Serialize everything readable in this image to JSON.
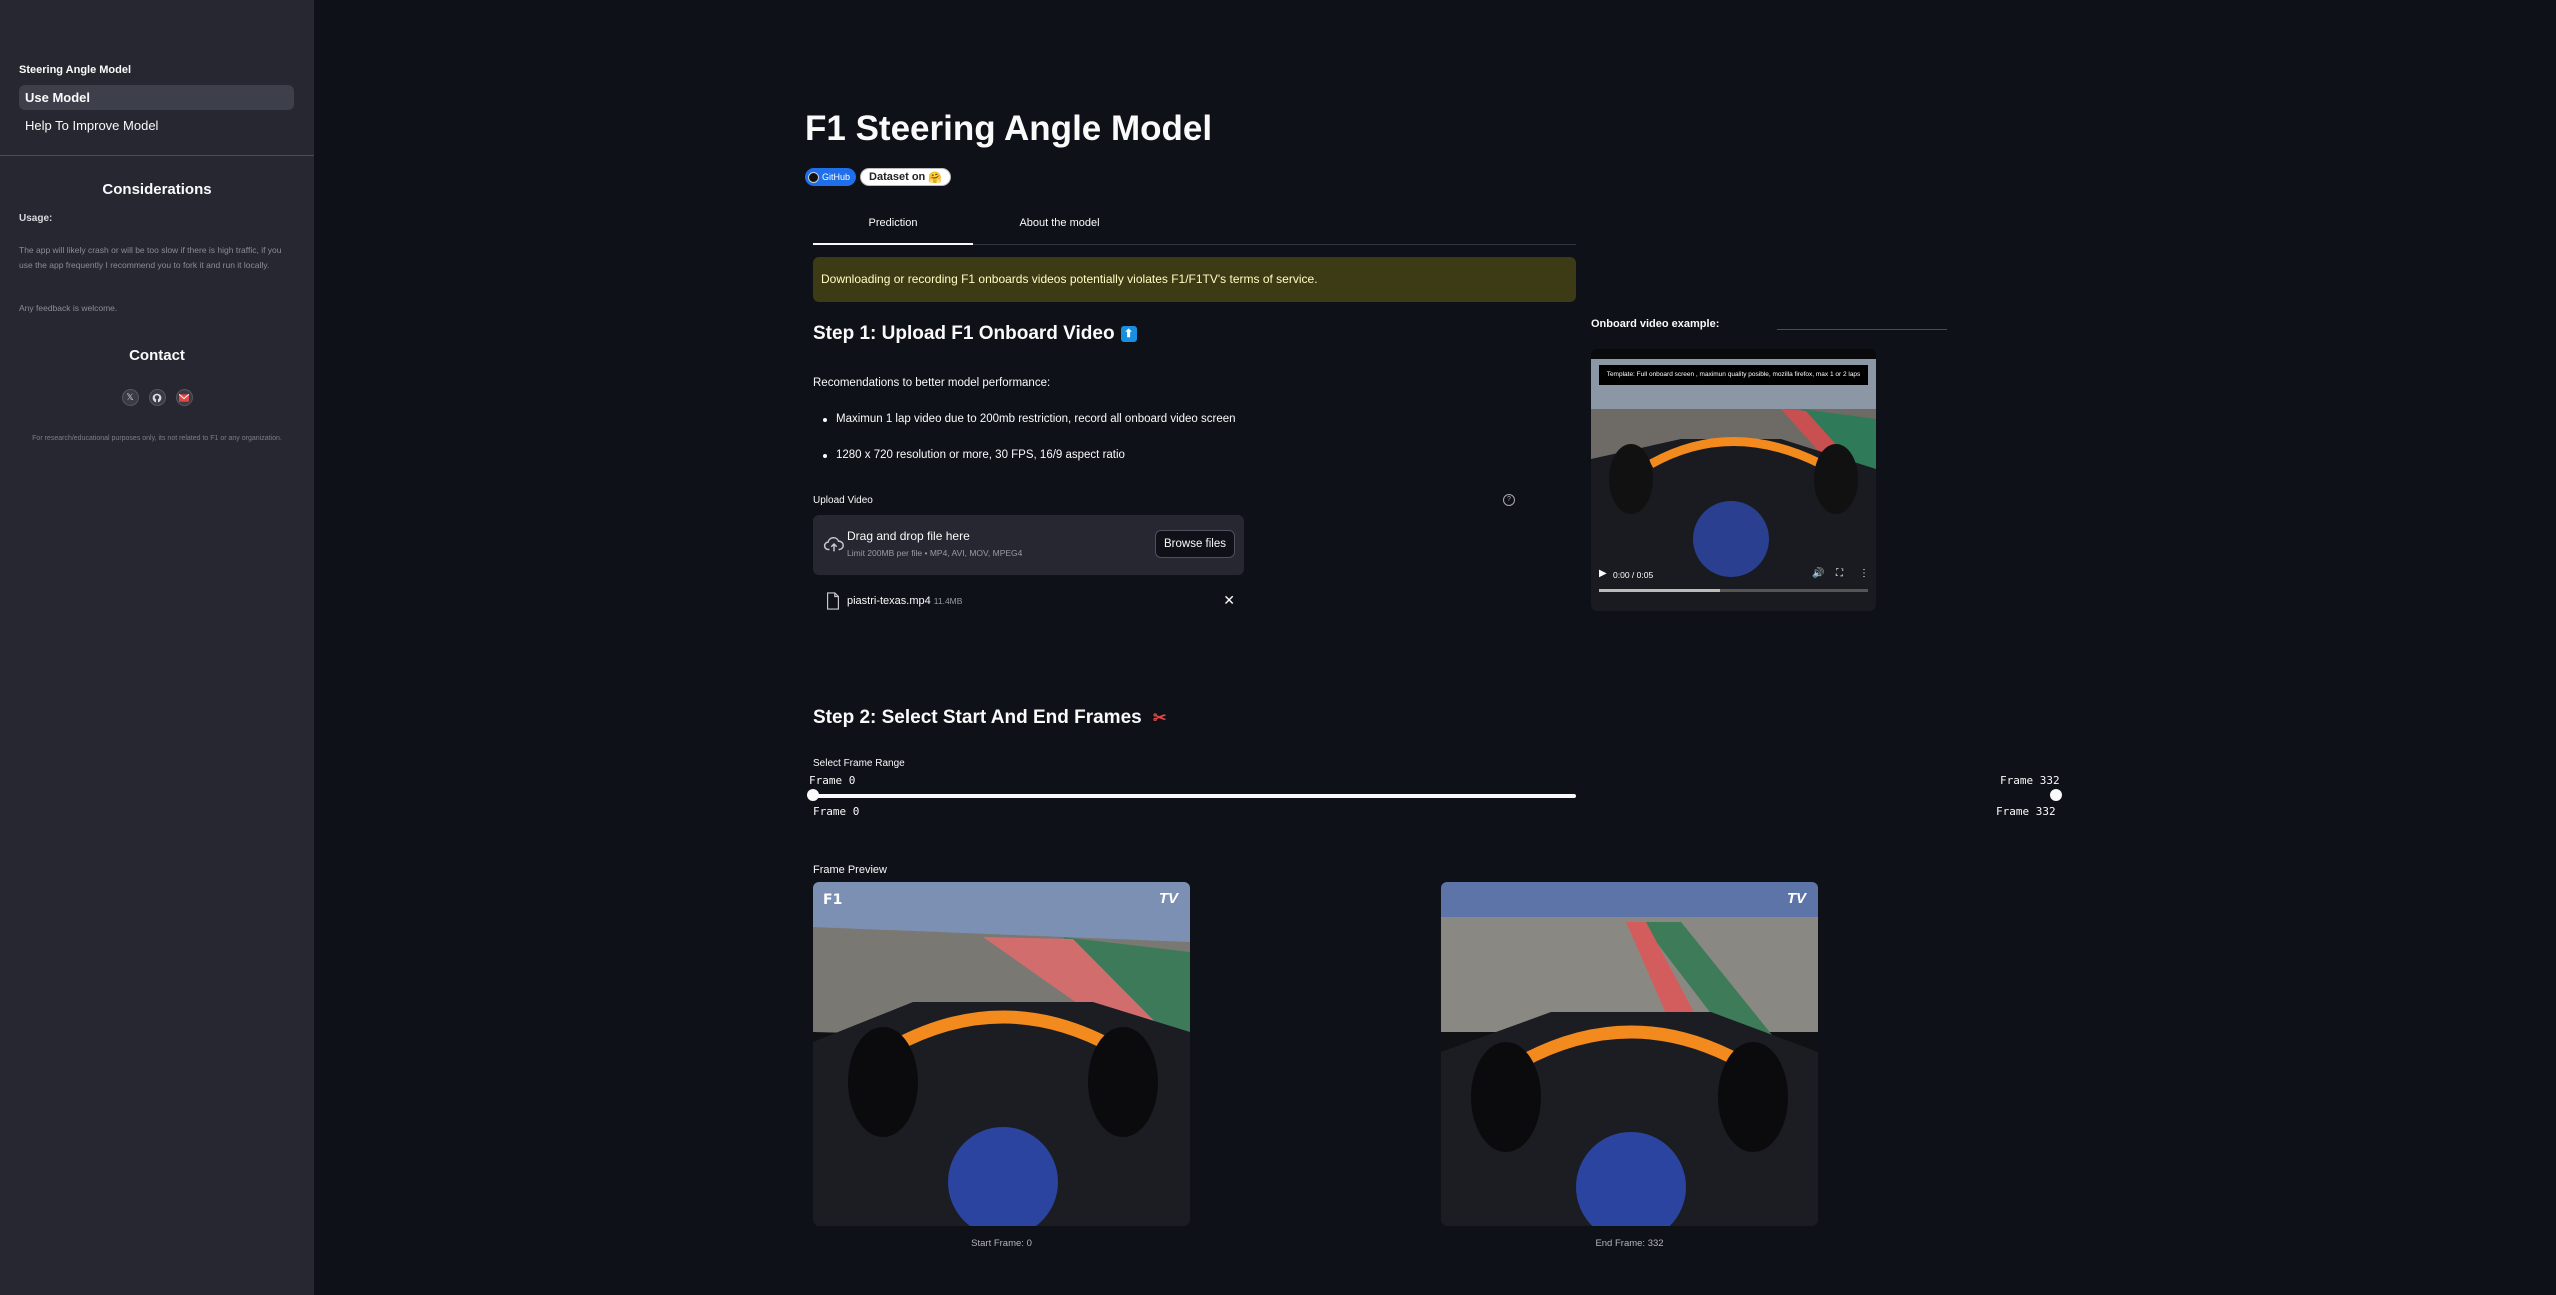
{
  "sidebar": {
    "app_title": "Steering Angle Model",
    "nav": [
      {
        "label": "Use Model",
        "active": true
      },
      {
        "label": "Help To Improve Model",
        "active": false
      }
    ],
    "considerations_heading": "Considerations",
    "usage_label": "Usage:",
    "usage_text": "The app will likely crash or will be too slow if there is high traffic, if you use the app frequently I recommend you to fork it and run it locally.",
    "feedback_text": "Any feedback is welcome.",
    "contact_heading": "Contact",
    "contact_icons": [
      "x-icon",
      "github-icon",
      "email-icon"
    ],
    "footer": "For research/educational purposes only, its not related to F1 or any organization."
  },
  "main": {
    "title": "F1 Steering Angle Model",
    "badges": {
      "github": "GitHub",
      "dataset_prefix": "Dataset on",
      "dataset_emoji": "🤗"
    },
    "tabs": [
      "Prediction",
      "About the model"
    ],
    "warning": "Downloading or recording F1 onboards videos potentially violates F1/F1TV's terms of service.",
    "step1": {
      "heading": "Step 1: Upload F1 Onboard Video",
      "emoji": "⬆",
      "reco_heading": "Recomendations to better model performance:",
      "bullets": [
        "Maximun 1 lap video due to 200mb restriction, record all onboard video screen",
        "1280 x 720 resolution or more, 30 FPS, 16/9 aspect ratio"
      ],
      "upload_label": "Upload Video",
      "drop_title": "Drag and drop file here",
      "drop_limit": "Limit 200MB per file • MP4, AVI, MOV, MPEG4",
      "browse_label": "Browse files",
      "file_name": "piastri-texas.mp4",
      "file_size": "11.4MB"
    },
    "onboard": {
      "label": "Onboard video example:",
      "overlay_text": "Template:  Full onboard screen , maximun quality posible, mozilla firefox, max 1 or 2 laps",
      "time": "0:00 / 0:05",
      "progress": 0.45
    },
    "step2": {
      "heading": "Step 2: Select Start And End Frames",
      "emoji": "✂",
      "slider_label": "Select Frame Range",
      "min_label": "Frame 0",
      "max_label": "Frame 332",
      "start_value": "Frame 0",
      "end_value": "Frame 332",
      "preview_label": "Frame Preview",
      "start_caption": "Start Frame: 0",
      "end_caption": "End Frame: 332",
      "start_logo": "TV",
      "end_logo": "TV"
    }
  },
  "colors": {
    "background": "#0e1117",
    "sidebar": "#262730",
    "warning_bg": "#3d3a16",
    "warning_text": "#ffffc2",
    "accent_orange": "#f28a1e"
  }
}
